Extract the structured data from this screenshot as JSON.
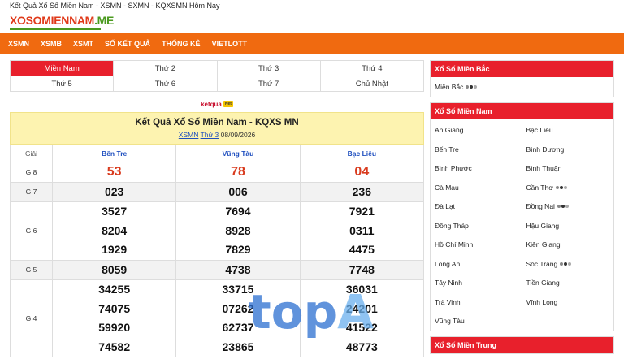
{
  "header": {
    "page_title": "Kết Quả Xổ Số Miền Nam - XSMN - SXMN - KQXSMN Hôm Nay",
    "logo_part1": "XOSO",
    "logo_part2": "MIENNAM",
    "logo_part3": ".ME"
  },
  "nav": [
    "XSMN",
    "XSMB",
    "XSMT",
    "SỐ KẾT QUẢ",
    "THỐNG KÊ",
    "VIETLOTT"
  ],
  "tabs": [
    {
      "label": "Miền Nam",
      "active": true
    },
    {
      "label": "Thứ 2"
    },
    {
      "label": "Thứ 3"
    },
    {
      "label": "Thứ 4"
    },
    {
      "label": "Thứ 5"
    },
    {
      "label": "Thứ 6"
    },
    {
      "label": "Thứ 7"
    },
    {
      "label": "Chủ Nhật"
    }
  ],
  "ketqua": {
    "label": "ketqua",
    "badge": "Net"
  },
  "result": {
    "title": "Kết Quả Xổ Số Miền Nam - KQXS MN",
    "link1": "XSMN",
    "link2": "Thứ 3",
    "date": "08/09/2026"
  },
  "table": {
    "col_giai": "Giải",
    "provinces": [
      "Bến Tre",
      "Vũng Tàu",
      "Bạc Liêu"
    ],
    "rows": [
      {
        "giai": "G.8",
        "values": [
          [
            "53"
          ],
          [
            "78"
          ],
          [
            "04"
          ]
        ],
        "red": true
      },
      {
        "giai": "G.7",
        "values": [
          [
            "023"
          ],
          [
            "006"
          ],
          [
            "236"
          ]
        ]
      },
      {
        "giai": "G.6",
        "values": [
          [
            "3527",
            "8204",
            "1929"
          ],
          [
            "7694",
            "8928",
            "7829"
          ],
          [
            "7921",
            "0311",
            "4475"
          ]
        ]
      },
      {
        "giai": "G.5",
        "values": [
          [
            "8059"
          ],
          [
            "4738"
          ],
          [
            "7748"
          ]
        ]
      },
      {
        "giai": "G.4",
        "values": [
          [
            "34255",
            "74075",
            "59920",
            "74582"
          ],
          [
            "33715",
            "07262",
            "62737",
            "23865"
          ],
          [
            "36031",
            "24201",
            "41522",
            "48773"
          ]
        ]
      }
    ]
  },
  "sidebar": {
    "bac": {
      "title": "Xổ Số Miền Bắc",
      "items": [
        "Miền Bắc"
      ]
    },
    "nam": {
      "title": "Xổ Số Miền Nam",
      "items": [
        "An Giang",
        "Bạc Liêu",
        "Bến Tre",
        "Bình Dương",
        "Bình Phước",
        "Bình Thuận",
        "Cà Mau",
        "Cần Thơ",
        "Đà Lạt",
        "Đồng Nai",
        "Đồng Tháp",
        "Hậu Giang",
        "Hồ Chí Minh",
        "Kiên Giang",
        "Long An",
        "Sóc Trăng",
        "Tây Ninh",
        "Tiền Giang",
        "Trà Vinh",
        "Vĩnh Long",
        "Vũng Tàu"
      ],
      "live": [
        "Cần Thơ",
        "Đồng Nai",
        "Sóc Trăng"
      ]
    },
    "trung": {
      "title": "Xổ Số Miền Trung"
    }
  },
  "watermark": {
    "part1": "top",
    "part2": "A"
  },
  "colors": {
    "accent": "#f06a10",
    "red": "#e8202c",
    "highlight": "#fdf3b0",
    "link": "#1f4fbf"
  }
}
